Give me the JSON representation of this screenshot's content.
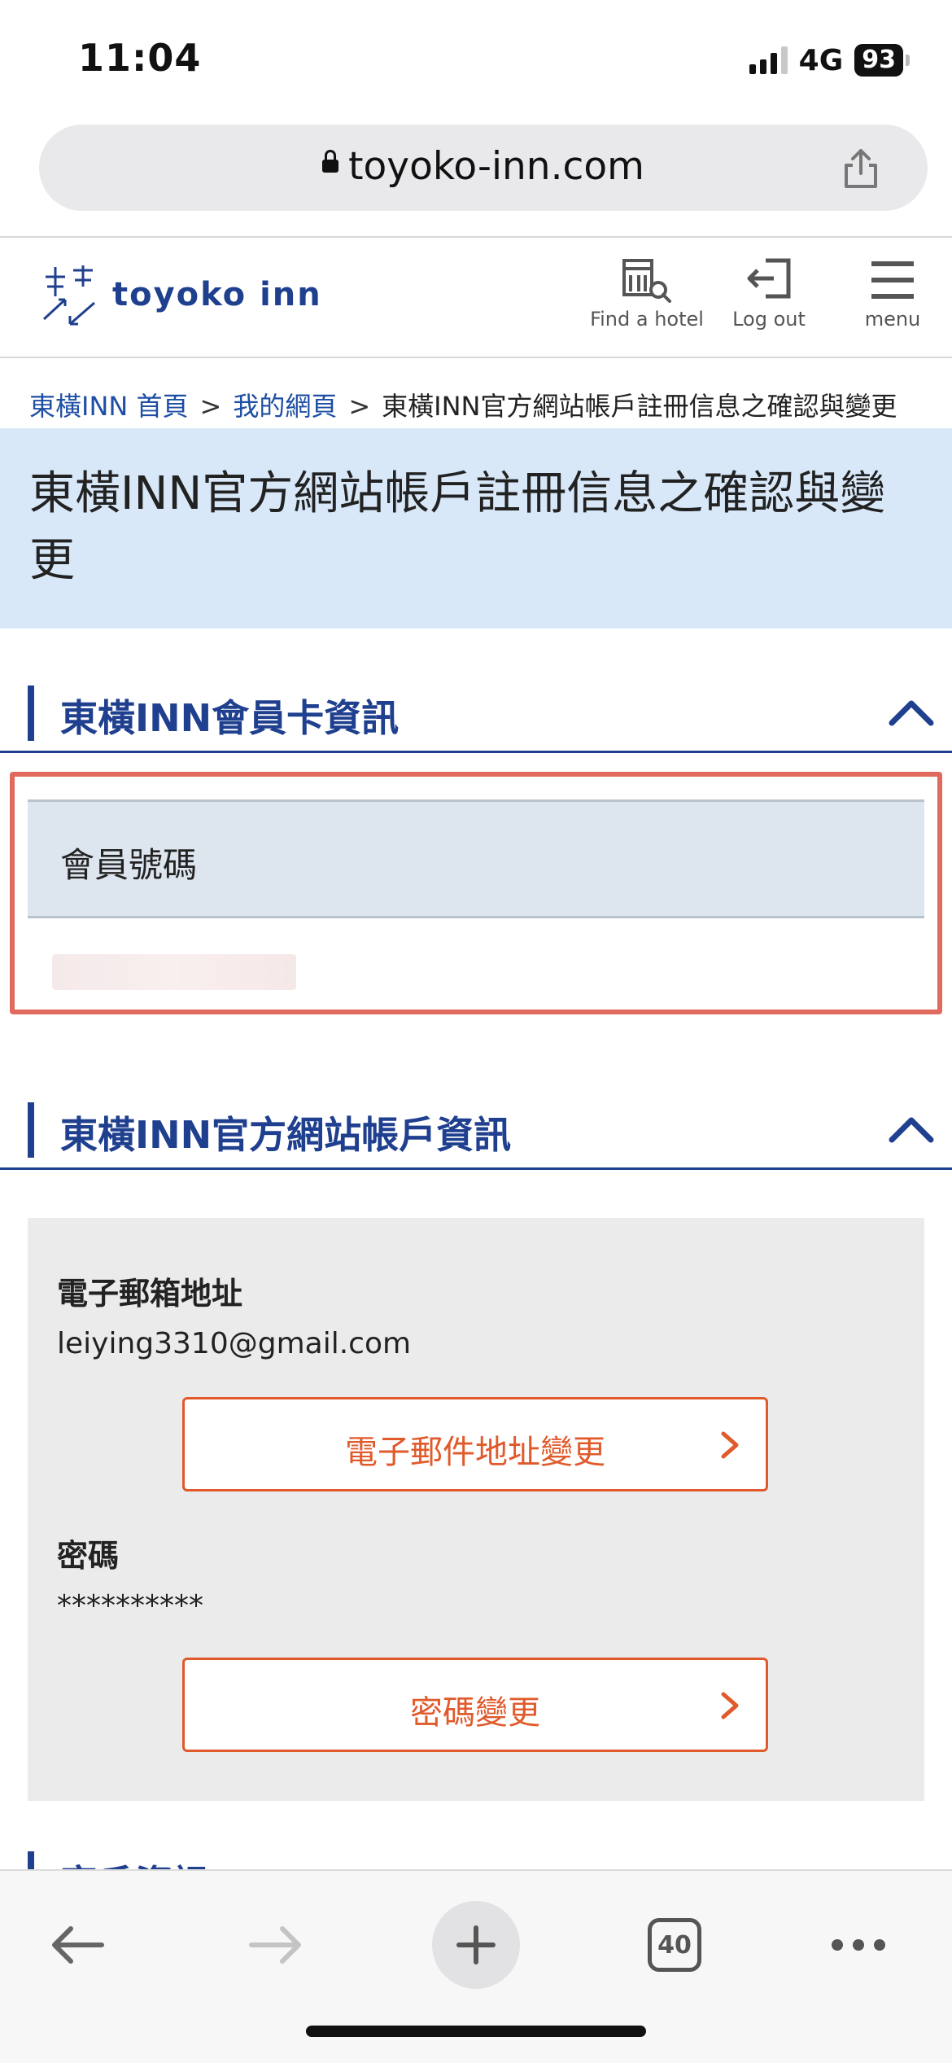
{
  "status_bar": {
    "time": "11:04",
    "network": "4G",
    "battery": "93"
  },
  "browser": {
    "url": "toyoko-inn.com"
  },
  "header": {
    "logo_text": "toyoko inn",
    "nav": [
      {
        "label": "Find a hotel",
        "icon": "find-hotel-icon"
      },
      {
        "label": "Log out",
        "icon": "logout-icon"
      },
      {
        "label": "menu",
        "icon": "hamburger-menu-icon"
      }
    ]
  },
  "breadcrumb": {
    "items": [
      "東橫INN 首頁",
      "我的網頁",
      "東橫INN官方網站帳戶註冊信息之確認與變更"
    ],
    "separator": ">"
  },
  "page": {
    "title": "東橫INN官方網站帳戶註冊信息之確認與變更"
  },
  "member_card": {
    "section_title": "東橫INN會員卡資訊",
    "number_label": "會員號碼"
  },
  "account": {
    "section_title": "東橫INN官方網站帳戶資訊",
    "email_label": "電子郵箱地址",
    "email_value": "leiying3310@gmail.com",
    "email_change_button": "電子郵件地址變更",
    "password_label": "密碼",
    "password_value": "**********",
    "password_change_button": "密碼變更"
  },
  "next_section": {
    "title": "客戶資訊"
  },
  "toolbar": {
    "tab_count": "40"
  },
  "colors": {
    "brand_blue": "#1f3f8f",
    "link_blue": "#1e4fa3",
    "accent_orange": "#e05a2b",
    "highlight_red": "#e06a5e",
    "title_band": "#d8e8f8"
  }
}
